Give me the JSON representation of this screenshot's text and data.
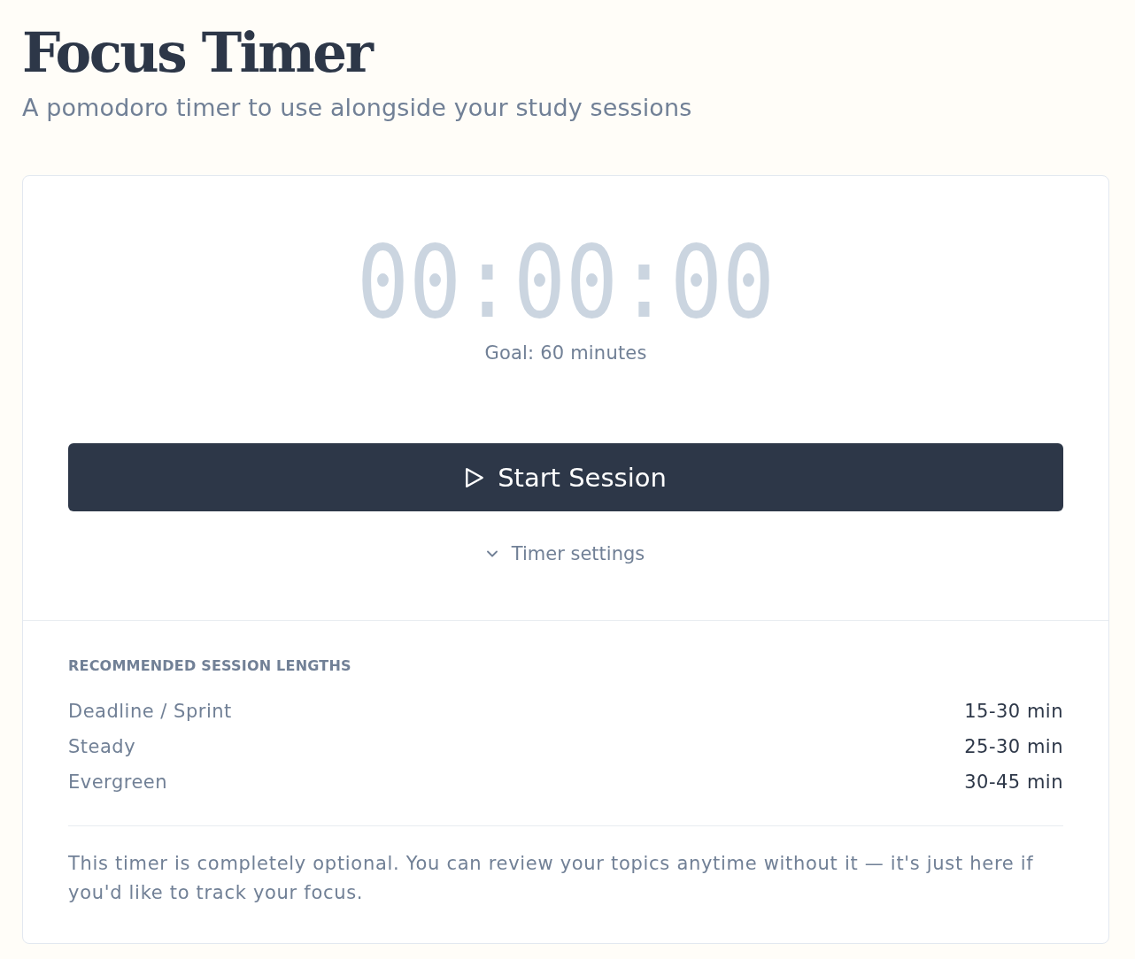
{
  "header": {
    "title": "Focus Timer",
    "subtitle": "A pomodoro timer to use alongside your study sessions"
  },
  "timer": {
    "display": "00:00:00",
    "goal": "Goal: 60 minutes",
    "start_button": {
      "label": "Start Session"
    },
    "settings_toggle": {
      "label": "Timer settings",
      "expanded": false
    }
  },
  "recommendations": {
    "heading": "RECOMMENDED SESSION LENGTHS",
    "rows": [
      {
        "label": "Deadline / Sprint",
        "value": "15-30 min"
      },
      {
        "label": "Steady",
        "value": "25-30 min"
      },
      {
        "label": "Evergreen",
        "value": "30-45 min"
      }
    ]
  },
  "note": "This timer is completely optional. You can review your topics anytime without it — it's just here if you'd like to track your focus."
}
